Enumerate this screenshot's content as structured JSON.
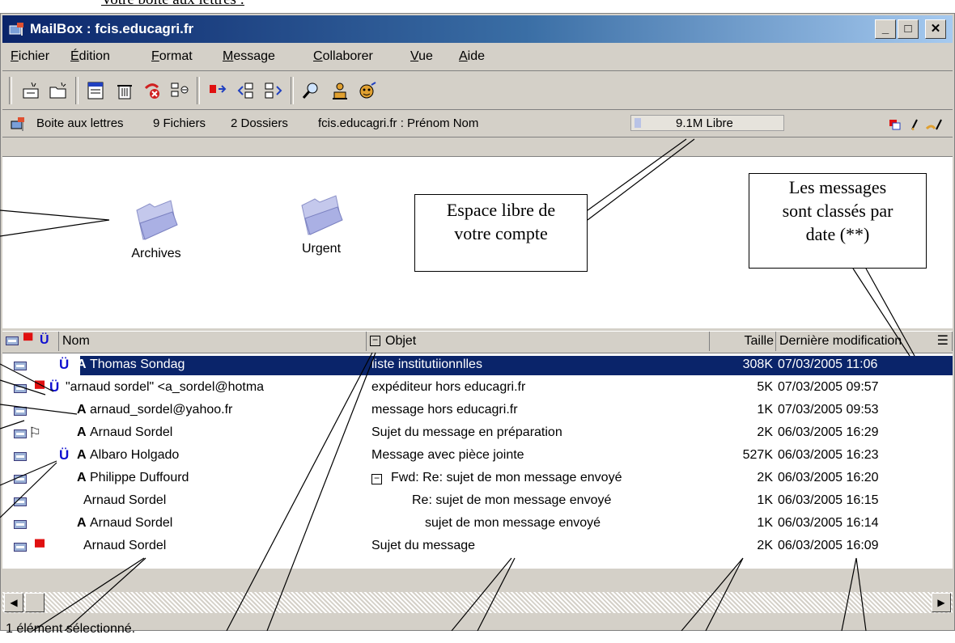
{
  "caption": "Votre boîte aux lettres :",
  "window": {
    "title": "MailBox : fcis.educagri.fr",
    "minimize": "_",
    "maximize": "□",
    "close": "✕"
  },
  "menu": [
    "Fichier",
    "Édition",
    "Format",
    "Message",
    "Collaborer",
    "Vue",
    "Aide"
  ],
  "toolbar_icons": [
    "new-message-icon",
    "new-folder-icon",
    "open-icon",
    "delete-icon",
    "recycle-icon",
    "properties-icon",
    "flag-icon",
    "reply-icon",
    "forward-icon",
    "search-icon",
    "user-icon",
    "smiley-icon"
  ],
  "infobar": {
    "label": "Boite aux lettres",
    "files": "9 Fichiers",
    "folders": "2 Dossiers",
    "account": "fcis.educagri.fr : Prénom Nom",
    "free": "9.1M Libre"
  },
  "folders": [
    {
      "name": "Archives"
    },
    {
      "name": "Urgent"
    }
  ],
  "columns": {
    "nom": "Nom",
    "objet": "Objet",
    "taille": "Taille",
    "date": "Dernière modification"
  },
  "messages": [
    {
      "name": "Thomas Sondag",
      "subject": "liste institutiionnlles",
      "size": "308K",
      "date": "07/03/2005  11:06",
      "a": "A",
      "selected": true
    },
    {
      "name": "\"arnaud sordel\" <a_sordel@hotma",
      "subject": "expéditeur hors educagri.fr",
      "size": "5K",
      "date": "07/03/2005  09:57",
      "a": ""
    },
    {
      "name": "arnaud_sordel@yahoo.fr",
      "subject": "message hors educagri.fr",
      "size": "1K",
      "date": "07/03/2005  09:53",
      "a": "A"
    },
    {
      "name": "Arnaud Sordel",
      "subject": "Sujet du message en préparation",
      "size": "2K",
      "date": "06/03/2005  16:29",
      "a": "A"
    },
    {
      "name": "Albaro Holgado",
      "subject": "Message avec pièce jointe",
      "size": "527K",
      "date": "06/03/2005  16:23",
      "a": "A"
    },
    {
      "name": "Philippe Duffourd",
      "subject": "Fwd: Re: sujet de mon message envoyé",
      "size": "2K",
      "date": "06/03/2005  16:20",
      "a": "A"
    },
    {
      "name": "Arnaud Sordel",
      "subject": "Re: sujet de mon message envoyé",
      "size": "1K",
      "date": "06/03/2005  16:15",
      "a": ""
    },
    {
      "name": "Arnaud Sordel",
      "subject": "sujet de mon message envoyé",
      "size": "1K",
      "date": "06/03/2005  16:14",
      "a": "A"
    },
    {
      "name": "Arnaud Sordel",
      "subject": "Sujet du message",
      "size": "2K",
      "date": "06/03/2005  16:09",
      "a": ""
    }
  ],
  "status": "1 élément sélectionné.",
  "callouts": {
    "free_space": [
      "Espace libre de",
      "votre compte"
    ],
    "sorted": [
      "Les messages",
      "sont classés par",
      "date (**)"
    ]
  },
  "colors": {
    "title_start": "#0a246a",
    "title_end": "#a6caf0",
    "selection": "#0a246a",
    "flag": "#e01010",
    "clip": "#1010d0"
  }
}
